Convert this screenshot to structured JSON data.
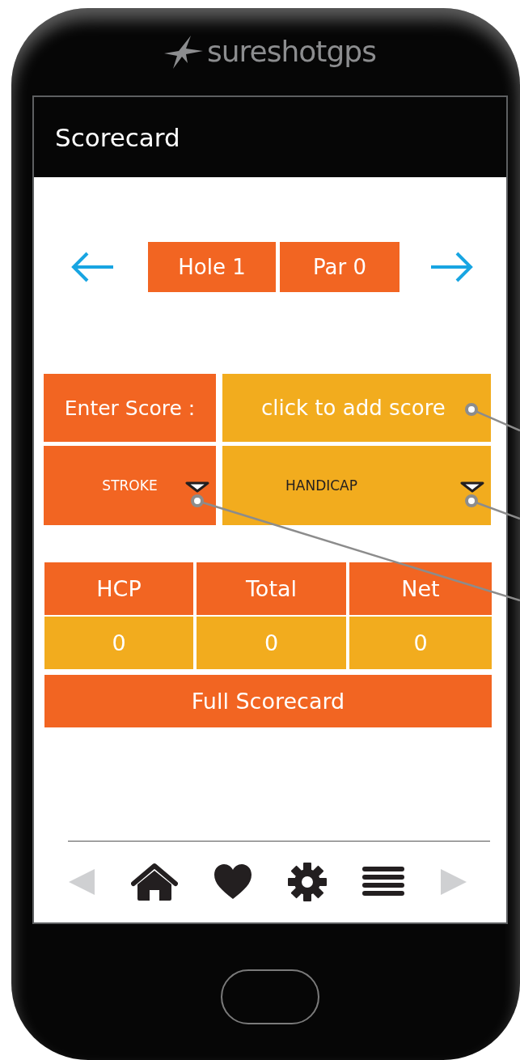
{
  "brand": {
    "name": "sureshotgps"
  },
  "header": {
    "title": "Scorecard"
  },
  "hole_nav": {
    "hole": "Hole 1",
    "par": "Par 0"
  },
  "score_entry": {
    "label": "Enter Score :",
    "placeholder": "click to add score"
  },
  "dropdowns": [
    {
      "value": "STROKE"
    },
    {
      "value": "HANDICAP"
    }
  ],
  "totals": {
    "columns": [
      "HCP",
      "Total",
      "Net"
    ],
    "values": [
      "0",
      "0",
      "0"
    ]
  },
  "full_scorecard_button": {
    "label": "Full Scorecard"
  },
  "bottom_nav": {
    "items": [
      {
        "kind": "back"
      },
      {
        "kind": "home"
      },
      {
        "kind": "favorite"
      },
      {
        "kind": "settings"
      },
      {
        "kind": "menu"
      },
      {
        "kind": "forward"
      }
    ]
  }
}
